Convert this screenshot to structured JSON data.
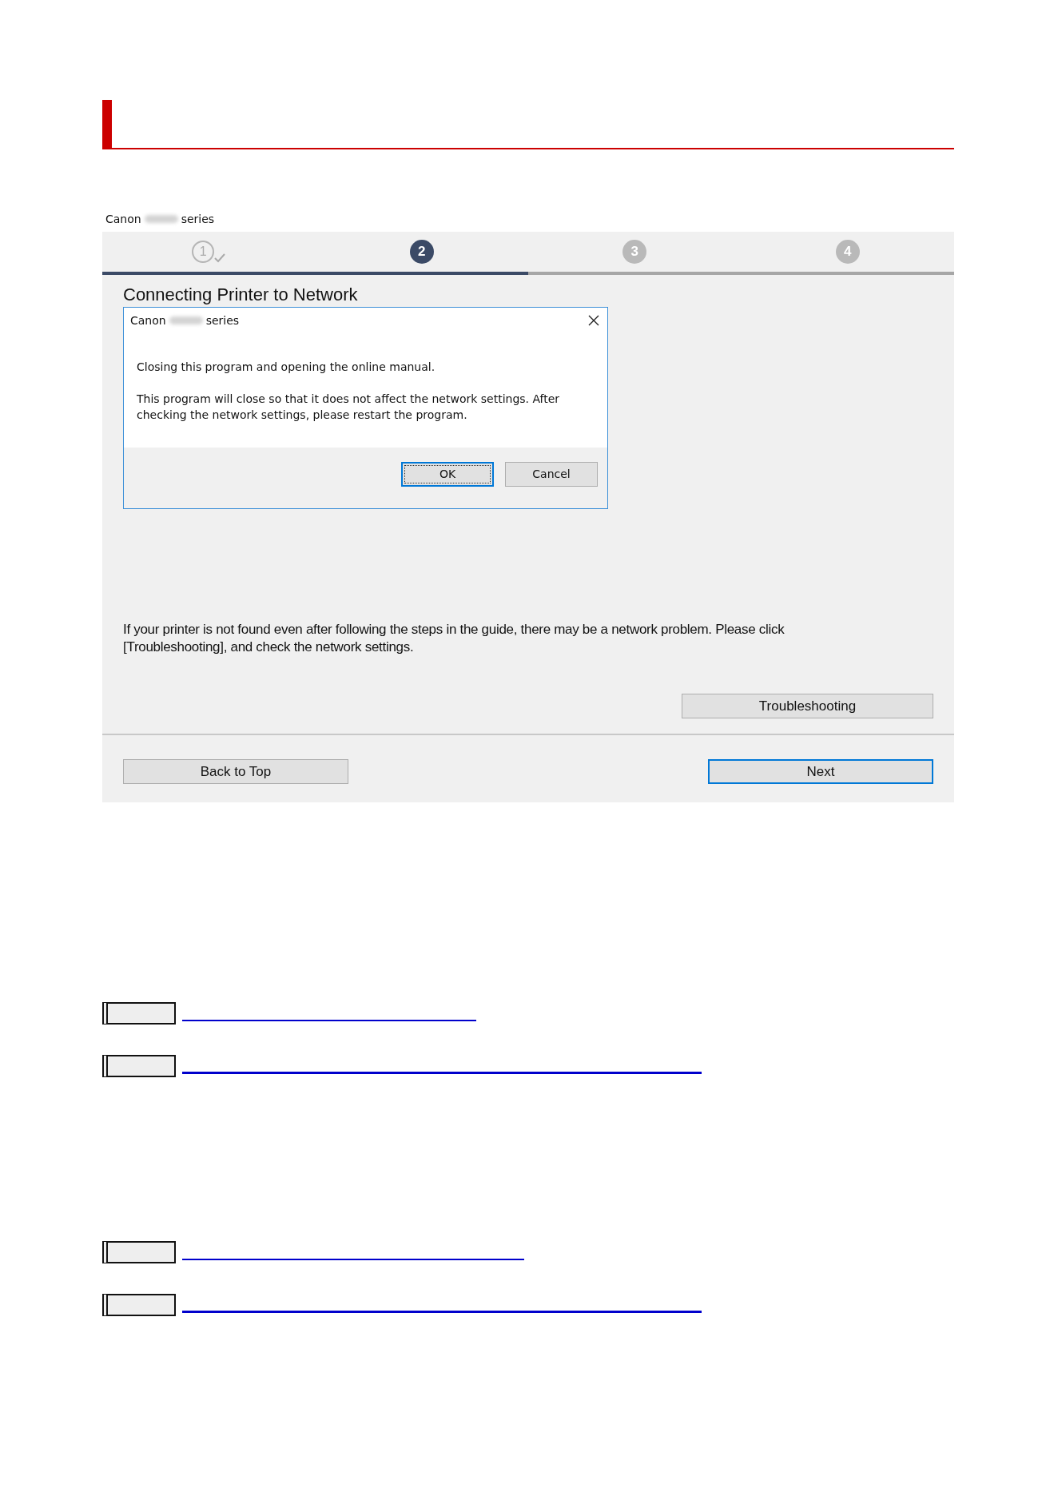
{
  "caption": {
    "brand": "Canon",
    "suffix": "series"
  },
  "wizard": {
    "steps": [
      {
        "label": "1",
        "completed": true,
        "selected": false
      },
      {
        "label": "2",
        "completed": false,
        "selected": true
      },
      {
        "label": "3",
        "completed": false,
        "selected": false
      },
      {
        "label": "4",
        "completed": false,
        "selected": false
      }
    ],
    "title": "Connecting Printer to Network",
    "dialog": {
      "brand": "Canon",
      "suffix": "series",
      "message": "Closing this program and opening the online manual.",
      "detail": "This program will close so that it does not affect the network settings. After checking the network settings, please restart the program.",
      "buttons": [
        {
          "label": "OK",
          "focused": true
        },
        {
          "label": "Cancel",
          "focused": false
        }
      ]
    },
    "info": "If your printer is not found even after following the steps in the guide, there may be a network problem. Please click [Troubleshooting], and check the network settings.",
    "troubleshoot_button": "Troubleshooting",
    "footer_buttons": [
      {
        "label": "Back to Top",
        "default": false
      },
      {
        "label": "Next",
        "default": true
      }
    ]
  },
  "link_groups": [
    {
      "links": [
        {
          "kind": "thin"
        },
        {
          "kind": "thick"
        }
      ]
    },
    {
      "links": [
        {
          "kind": "thin"
        },
        {
          "kind": "thick"
        }
      ]
    }
  ]
}
